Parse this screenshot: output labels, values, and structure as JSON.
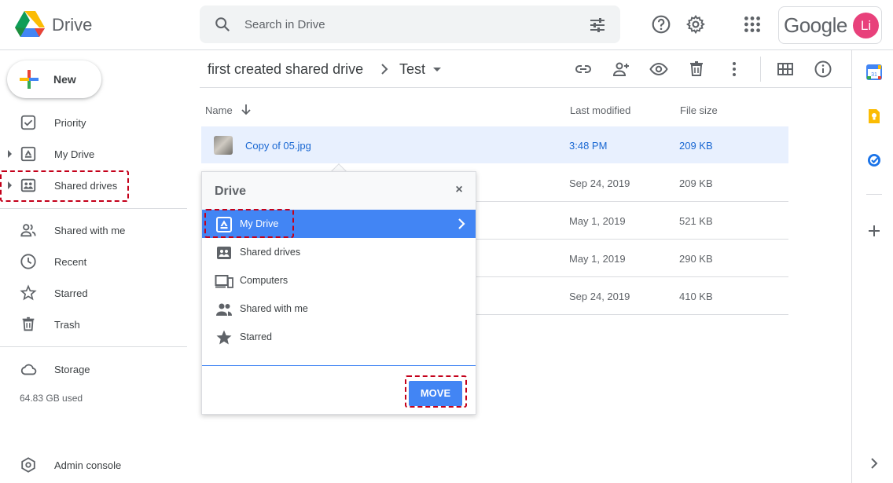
{
  "app": {
    "name": "Drive"
  },
  "search": {
    "placeholder": "Search in Drive"
  },
  "account": {
    "brand": "Google",
    "avatar_initials": "Li",
    "avatar_color": "#e8417b"
  },
  "sidebar": {
    "new_label": "New",
    "items": [
      {
        "label": "Priority",
        "icon": "priority-icon"
      },
      {
        "label": "My Drive",
        "icon": "my-drive-icon"
      },
      {
        "label": "Shared drives",
        "icon": "shared-drives-icon"
      },
      {
        "label": "Shared with me",
        "icon": "shared-with-me-icon"
      },
      {
        "label": "Recent",
        "icon": "clock-icon"
      },
      {
        "label": "Starred",
        "icon": "star-icon"
      },
      {
        "label": "Trash",
        "icon": "trash-icon"
      },
      {
        "label": "Storage",
        "icon": "cloud-icon"
      }
    ],
    "storage_used": "64.83 GB used",
    "admin_label": "Admin console"
  },
  "breadcrumb": {
    "parent": "first created shared drive",
    "current": "Test"
  },
  "table": {
    "headers": {
      "name": "Name",
      "modified": "Last modified",
      "size": "File size"
    },
    "rows": [
      {
        "name": "Copy of 05.jpg",
        "modified": "3:48 PM",
        "size": "209 KB",
        "selected": true
      },
      {
        "name": "",
        "modified": "Sep 24, 2019",
        "size": "209 KB"
      },
      {
        "name": "",
        "modified": "May 1, 2019",
        "size": "521 KB"
      },
      {
        "name": "",
        "modified": "May 1, 2019",
        "size": "290 KB"
      },
      {
        "name": "",
        "modified": "Sep 24, 2019",
        "size": "410 KB"
      }
    ]
  },
  "dialog": {
    "title": "Drive",
    "close_glyph": "×",
    "items": [
      {
        "label": "My Drive",
        "icon": "my-drive-icon",
        "active": true
      },
      {
        "label": "Shared drives",
        "icon": "shared-drives-icon"
      },
      {
        "label": "Computers",
        "icon": "computers-icon"
      },
      {
        "label": "Shared with me",
        "icon": "shared-with-me-icon"
      },
      {
        "label": "Starred",
        "icon": "star-icon"
      }
    ],
    "move_label": "MOVE"
  },
  "colors": {
    "accent": "#4285f4",
    "selected_row": "#e8f0fe",
    "highlight_dashed": "#c4001a"
  }
}
